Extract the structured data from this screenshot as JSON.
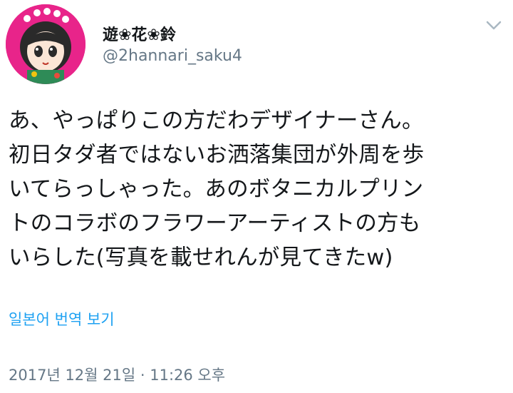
{
  "tweet": {
    "display_name": "遊❀花❀鈴",
    "handle": "@2hannari_saku4",
    "text": "あ、やっぱりこの方だわデザイナーさん。\n初日タダ者ではないお洒落集団が外周を歩\nいてらっしゃった。あのボタニカルプリン\nトのコラボのフラワーアーティストの方も\nいらした(写真を載せれんが見てきたw)",
    "translate_label": "일본어 번역 보기",
    "timestamp": "2017년 12월 21일 · 11:26 오후"
  },
  "icons": {
    "avatar": "avatar-illustration",
    "menu": "chevron-down-icon"
  },
  "colors": {
    "link": "#1da1f2",
    "secondary_text": "#657786",
    "avatar_ring": "#e8248a"
  }
}
